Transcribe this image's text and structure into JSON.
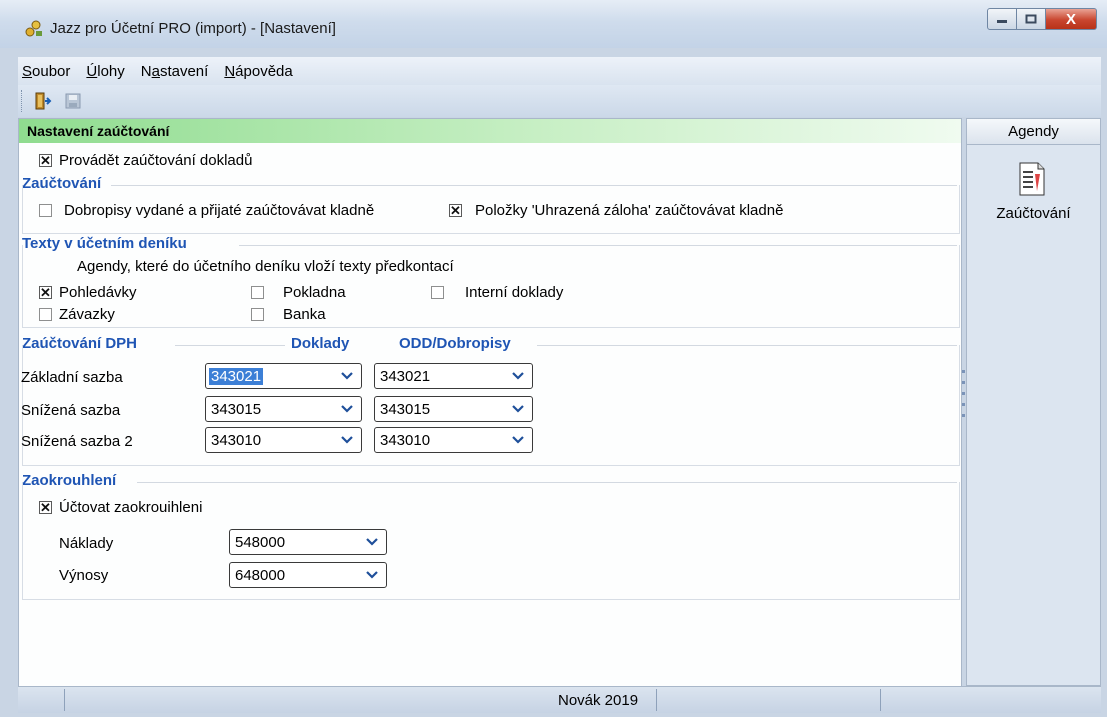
{
  "window": {
    "title": "Jazz pro Účetní PRO (import) - [Nastavení]",
    "close_symbol": "X"
  },
  "menu": [
    {
      "pre": "",
      "u": "S",
      "post": "oubor"
    },
    {
      "pre": "",
      "u": "Ú",
      "post": "lohy"
    },
    {
      "pre": "N",
      "u": "a",
      "post": "stavení"
    },
    {
      "pre": "",
      "u": "N",
      "post": "ápověda"
    }
  ],
  "panel": {
    "header": "Nastavení zaúčtování"
  },
  "provadet": {
    "checked": true,
    "label": "Provádět zaúčtování dokladů"
  },
  "zauctovani": {
    "title": "Zaúčtování",
    "dobropisy": {
      "checked": false,
      "label": "Dobropisy vydané a přijaté zaúčtovávat kladně"
    },
    "polozky": {
      "checked": true,
      "label": "Položky 'Uhrazená záloha' zaúčtovávat kladně"
    }
  },
  "texty": {
    "title": "Texty v účetním deníku",
    "description": "Agendy, které do účetního deníku vloží texty předkontací",
    "pohledavky": {
      "checked": true,
      "label": "Pohledávky"
    },
    "zavazky": {
      "checked": false,
      "label": "Závazky"
    },
    "pokladna": {
      "checked": false,
      "label": "Pokladna"
    },
    "banka": {
      "checked": false,
      "label": "Banka"
    },
    "interni": {
      "checked": false,
      "label": "Interní doklady"
    }
  },
  "dph": {
    "title": "Zaúčtování DPH",
    "col_doklady": "Doklady",
    "col_odd": "ODD/Dobropisy",
    "rows": [
      {
        "label": "Základní sazba",
        "doklady": "343021",
        "odd": "343021"
      },
      {
        "label": "Snížená sazba",
        "doklady": "343015",
        "odd": "343015"
      },
      {
        "label": "Snížená sazba 2",
        "doklady": "343010",
        "odd": "343010"
      }
    ]
  },
  "zaokrouhleni": {
    "title": "Zaokrouhlení",
    "uctovat": {
      "checked": true,
      "label": "Účtovat zaokrouihleni"
    },
    "naklady": {
      "label": "Náklady",
      "value": "548000"
    },
    "vynosy": {
      "label": "Výnosy",
      "value": "648000"
    }
  },
  "agendy": {
    "header": "Agendy",
    "item": "Zaúčtování"
  },
  "status": {
    "text": "Novák 2019"
  }
}
